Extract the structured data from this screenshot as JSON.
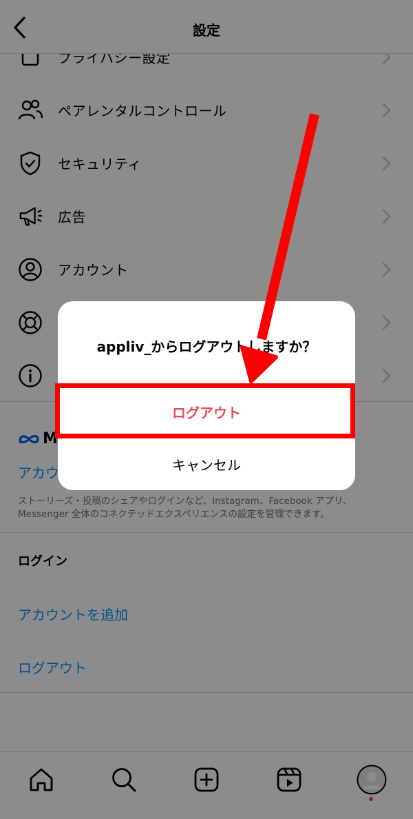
{
  "header": {
    "title": "設定"
  },
  "menu": [
    {
      "label": "プライバシー設定",
      "icon": "lock-icon"
    },
    {
      "label": "ペアレンタルコントロール",
      "icon": "people-icon"
    },
    {
      "label": "セキュリティ",
      "icon": "shield-icon"
    },
    {
      "label": "広告",
      "icon": "megaphone-icon"
    },
    {
      "label": "アカウント",
      "icon": "account-icon"
    },
    {
      "label": "",
      "icon": "help-lifebuoy-icon"
    },
    {
      "label": "",
      "icon": "info-icon"
    }
  ],
  "meta": {
    "logo_letter": "M",
    "accounts_center": "アカウ",
    "description": "ストーリーズ・投稿のシェアやログインなど、Instagram、Facebook アプリ、Messenger 全体のコネクテッドエクスペリエンスの設定を管理できます。"
  },
  "login_section": {
    "title": "ログイン",
    "add_account": "アカウントを追加",
    "logout": "ログアウト"
  },
  "dialog": {
    "title": "appliv_からログアウトしますか？",
    "logout_button": "ログアウト",
    "cancel_button": "キャンセル"
  },
  "tabs": [
    "home-icon",
    "search-icon",
    "create-icon",
    "reels-icon",
    "profile-icon"
  ],
  "colors": {
    "link": "#0095f6",
    "destructive": "#ed4956",
    "annotation": "#ff0000"
  }
}
